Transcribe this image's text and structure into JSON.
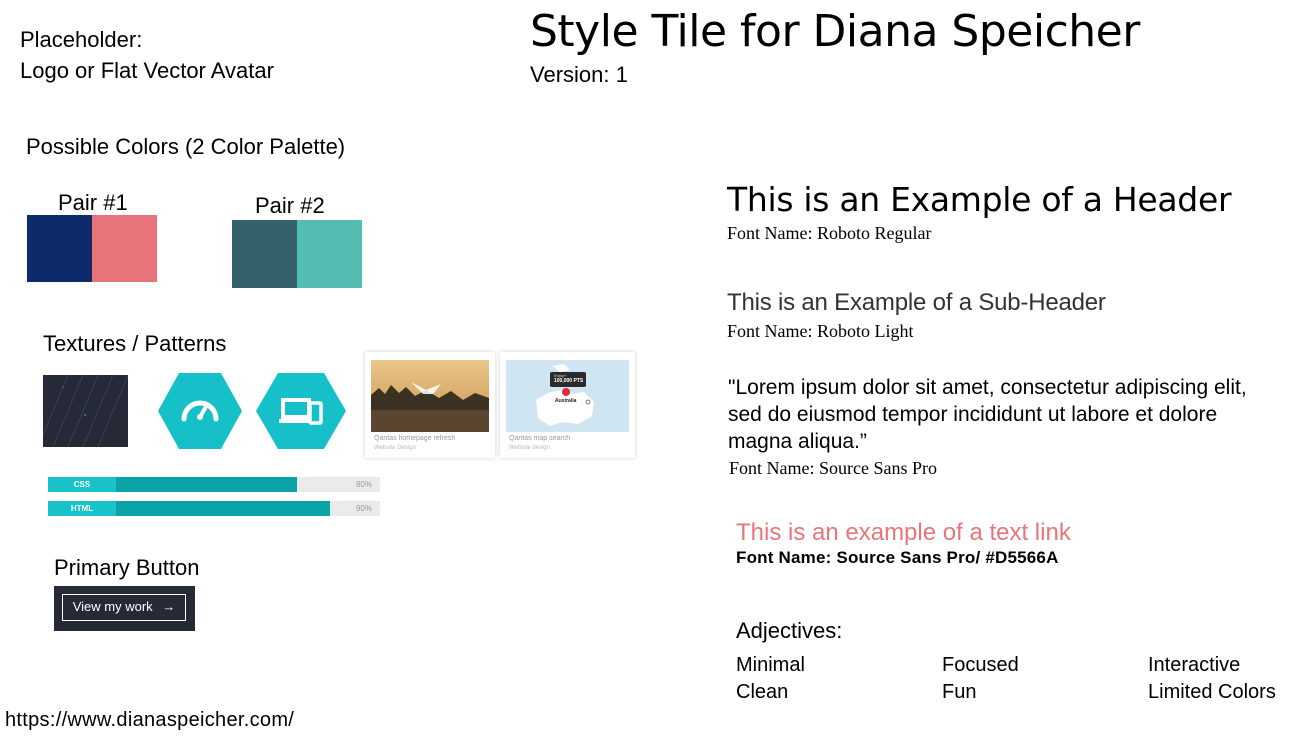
{
  "placeholder": {
    "line1": "Placeholder:",
    "line2": "Logo or Flat Vector Avatar"
  },
  "title": "Style Tile for Diana Speicher",
  "version": "Version: 1",
  "colors": {
    "title": "Possible Colors (2 Color Palette)",
    "pair1": {
      "label": "Pair #1",
      "color_a": "#0D2B6B",
      "color_b": "#E8737A"
    },
    "pair2": {
      "label": "Pair #2",
      "color_a": "#34616A",
      "color_b": "#52BDB0"
    }
  },
  "textures": {
    "title": "Textures  / Patterns",
    "icons": [
      "speedometer-icon",
      "devices-icon"
    ],
    "hex_color": "#16C0C8",
    "cards": [
      {
        "title": "Qantas homepage refresh",
        "subtitle": "Website Design"
      },
      {
        "title": "Qantas map search",
        "subtitle": "Website design",
        "map_points": "100,000 PTS",
        "map_label": "Australia",
        "map_small": "Enjoy+"
      }
    ],
    "skills": [
      {
        "label": "CSS",
        "percent_text": "80%",
        "fill": 0.75
      },
      {
        "label": "HTML",
        "percent_text": "90%",
        "fill": 0.85
      }
    ]
  },
  "button": {
    "title": "Primary Button",
    "label": "View my work",
    "arrow": "→"
  },
  "url": "https://www.dianaspeicher.com/",
  "typography": {
    "header": "This is an Example of a Header",
    "header_font": "Font Name: Roboto Regular",
    "subheader": "This is an Example of a Sub-Header",
    "subheader_font": "Font Name: Roboto Light",
    "quote": "\"Lorem ipsum dolor sit amet, consectetur adipiscing elit, sed do eiusmod tempor incididunt ut labore et dolore magna aliqua.”",
    "quote_font": "Font Name: Source Sans Pro",
    "link": "This is an example of a text link",
    "link_font": "Font Name: Source Sans Pro/ #D5566A"
  },
  "adjectives": {
    "title": "Adjectives:",
    "items": [
      "Minimal",
      "Focused",
      "Interactive",
      "Clean",
      "Fun",
      "Limited Colors"
    ]
  }
}
